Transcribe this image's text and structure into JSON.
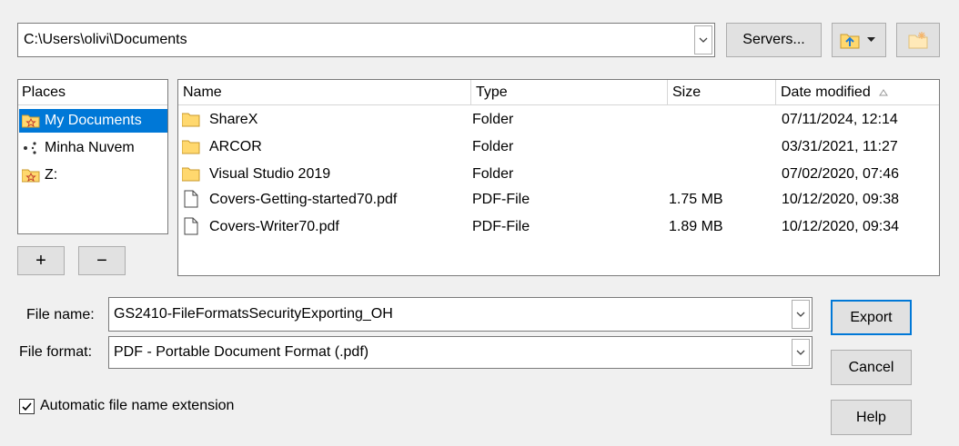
{
  "path": {
    "value": "C:\\Users\\olivi\\Documents"
  },
  "toolbar": {
    "servers_label": "Servers..."
  },
  "places": {
    "header": "Places",
    "items": [
      {
        "label": "My Documents",
        "icon": "folder-star-icon",
        "selected": true
      },
      {
        "label": "Minha Nuvem",
        "icon": "share-network-icon",
        "selected": false
      },
      {
        "label": "Z:",
        "icon": "folder-star-icon",
        "selected": false
      }
    ],
    "add_label": "+",
    "remove_label": "−"
  },
  "files": {
    "columns": [
      "Name",
      "Type",
      "Size",
      "Date modified"
    ],
    "rows": [
      {
        "name": "ShareX",
        "type": "Folder",
        "size": "",
        "date": "07/11/2024, 12:14",
        "icon": "folder-icon"
      },
      {
        "name": "ARCOR",
        "type": "Folder",
        "size": "",
        "date": "03/31/2021, 11:27",
        "icon": "folder-icon"
      },
      {
        "name": "Visual Studio 2019",
        "type": "Folder",
        "size": "",
        "date": "07/02/2020, 07:46",
        "icon": "folder-icon"
      },
      {
        "name": "Covers-Getting-started70.pdf",
        "type": "PDF-File",
        "size": "1.75 MB",
        "date": "10/12/2020, 09:38",
        "icon": "file-icon"
      },
      {
        "name": "Covers-Writer70.pdf",
        "type": "PDF-File",
        "size": "1.89 MB",
        "date": "10/12/2020, 09:34",
        "icon": "file-icon"
      }
    ]
  },
  "filename": {
    "label": "File name:",
    "value": "GS2410-FileFormatsSecurityExporting_OH"
  },
  "fileformat": {
    "label": "File format:",
    "value": "PDF - Portable Document Format (.pdf)"
  },
  "auto_ext": {
    "label": "Automatic file name extension",
    "checked": true
  },
  "buttons": {
    "export": "Export",
    "cancel": "Cancel",
    "help": "Help"
  },
  "colors": {
    "selection": "#0078d7",
    "folder": "#ffd86e",
    "default_border": "#0078d7"
  }
}
